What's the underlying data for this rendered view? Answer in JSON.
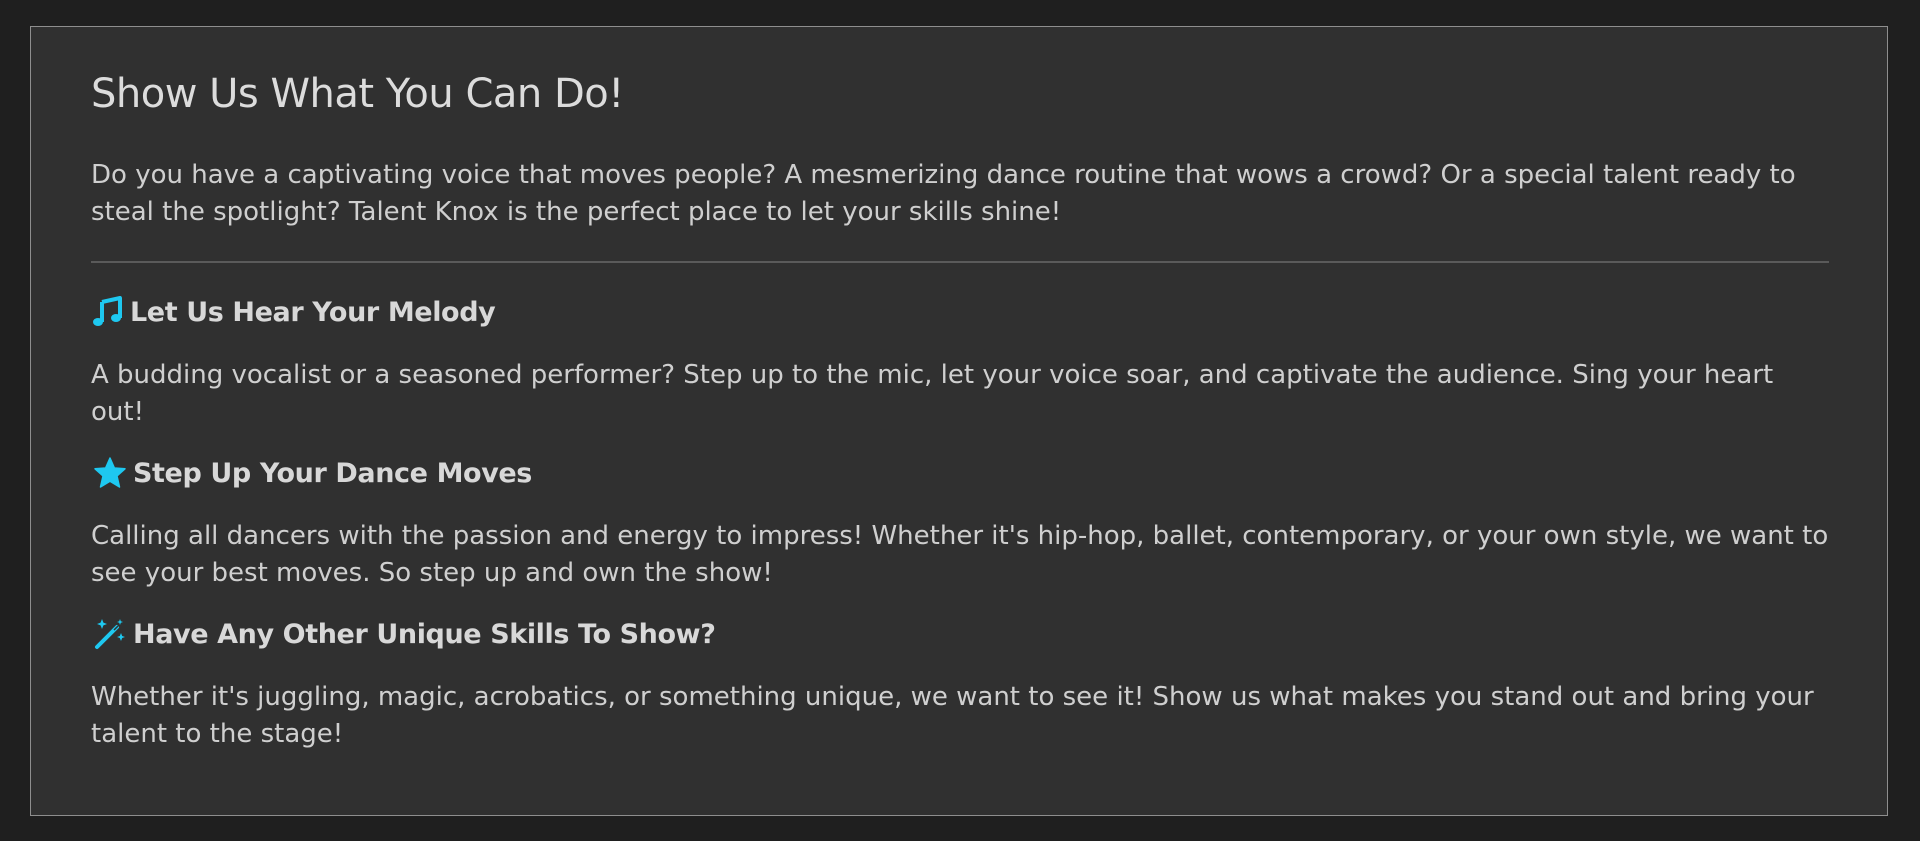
{
  "accent_color": "#1ec8f0",
  "title": "Show Us What You Can Do!",
  "intro": "Do you have a captivating voice that moves people? A mesmerizing dance routine that wows a crowd? Or a special talent ready to steal the spotlight? Talent Knox is the perfect place to let your skills shine!",
  "sections": [
    {
      "icon": "music-note-icon",
      "heading": "Let Us Hear Your Melody",
      "body": "A budding vocalist or a seasoned performer? Step up to the mic, let your voice soar, and captivate the audience. Sing your heart out!"
    },
    {
      "icon": "star-icon",
      "heading": "Step Up Your Dance Moves",
      "body": "Calling all dancers with the passion and energy to impress! Whether it's hip-hop, ballet, contemporary, or your own style, we want to see your best moves. So step up and own the show!"
    },
    {
      "icon": "magic-wand-icon",
      "heading": "Have Any Other Unique Skills To Show?",
      "body": "Whether it's juggling, magic, acrobatics, or something unique, we want to see it! Show us what makes you stand out and bring your talent to the stage!"
    }
  ]
}
